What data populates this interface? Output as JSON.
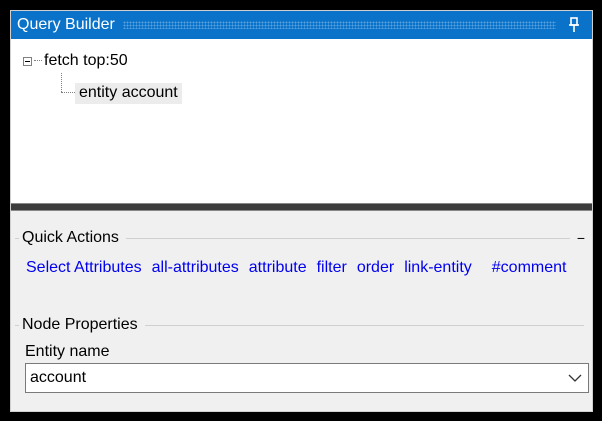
{
  "panel": {
    "title": "Query Builder"
  },
  "tree": {
    "root_label": "fetch top:50",
    "child_label": "entity account"
  },
  "quick_actions": {
    "title": "Quick Actions",
    "collapse_glyph": "−",
    "links": [
      {
        "label": "Select Attributes"
      },
      {
        "label": "all-attributes"
      },
      {
        "label": "attribute"
      },
      {
        "label": "filter"
      },
      {
        "label": "order"
      },
      {
        "label": "link-entity"
      },
      {
        "label": "#comment"
      }
    ]
  },
  "node_properties": {
    "title": "Node Properties",
    "entity_name_label": "Entity name",
    "entity_name_value": "account"
  },
  "colors": {
    "titlebar": "#0a73c9",
    "link": "#0000ee"
  }
}
